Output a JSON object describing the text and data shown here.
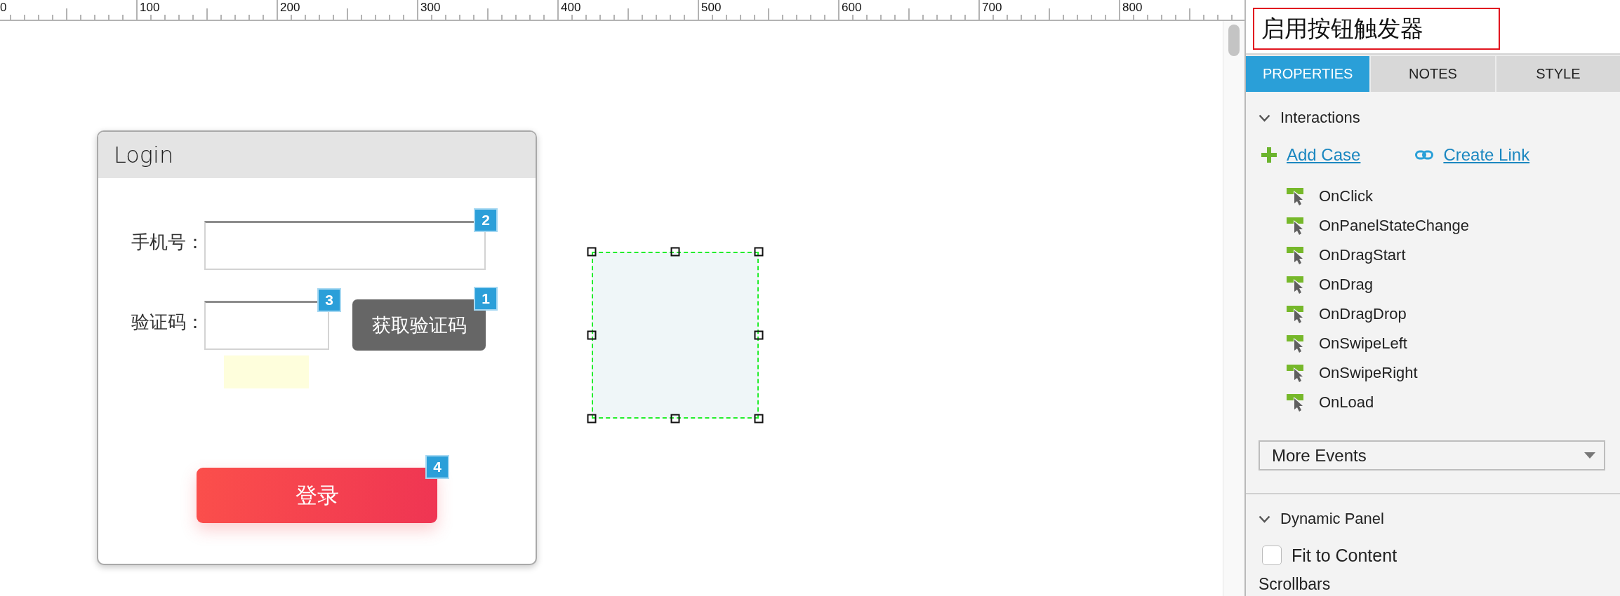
{
  "ruler": {
    "labels": [
      "0",
      "100",
      "200",
      "300",
      "400",
      "500",
      "600",
      "700",
      "800"
    ]
  },
  "canvas": {
    "login_form": {
      "title": "Login",
      "phone": {
        "label": "手机号：",
        "badge": "2"
      },
      "code": {
        "label": "验证码：",
        "badge": "3"
      },
      "get_code_button": {
        "label": "获取验证码",
        "badge": "1"
      },
      "login_button": {
        "label": "登录",
        "badge": "4"
      }
    },
    "shape": {
      "selected": true
    }
  },
  "inspector": {
    "widget_name": "启用按钮触发器",
    "tabs": [
      {
        "label": "PROPERTIES",
        "selected": true
      },
      {
        "label": "NOTES",
        "selected": false
      },
      {
        "label": "STYLE",
        "selected": false
      }
    ],
    "interactions": {
      "title": "Interactions",
      "expanded": true,
      "actions": [
        {
          "kind": "add",
          "label": "Add Case"
        },
        {
          "kind": "link",
          "label": "Create Link"
        }
      ],
      "events": [
        "OnClick",
        "OnPanelStateChange",
        "OnDragStart",
        "OnDrag",
        "OnDragDrop",
        "OnSwipeLeft",
        "OnSwipeRight",
        "OnLoad"
      ],
      "more_events": "More Events"
    },
    "dynamic_panel": {
      "title": "Dynamic Panel",
      "expanded": true,
      "fit_to_content": {
        "label": "Fit to Content",
        "checked": false
      },
      "next_heading": "Scrollbars"
    }
  }
}
